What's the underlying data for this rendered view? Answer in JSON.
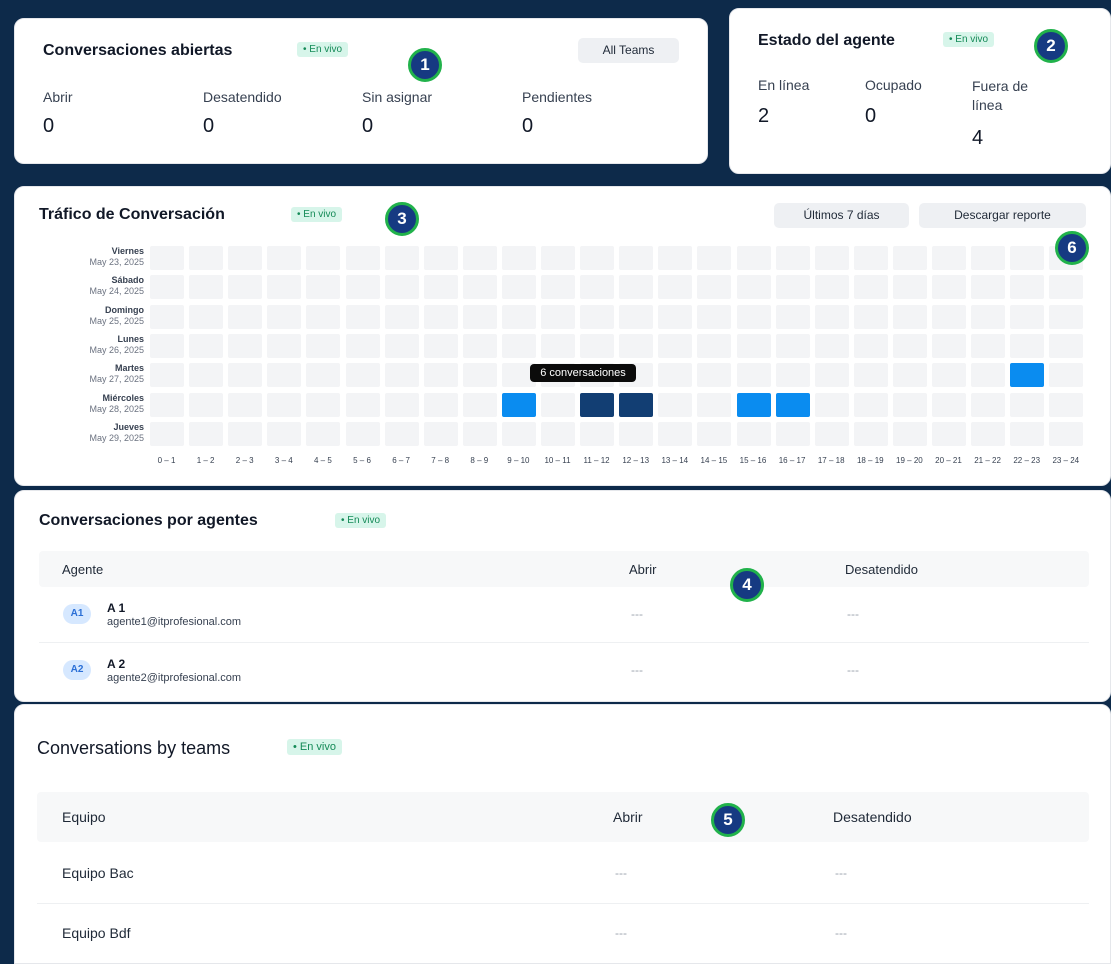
{
  "live_label": "• En vivo",
  "open_conversations": {
    "title": "Conversaciones abiertas",
    "team_filter": "All Teams",
    "stats": [
      {
        "label": "Abrir",
        "value": "0"
      },
      {
        "label": "Desatendido",
        "value": "0"
      },
      {
        "label": "Sin asignar",
        "value": "0"
      },
      {
        "label": "Pendientes",
        "value": "0"
      }
    ]
  },
  "agent_status": {
    "title": "Estado del agente",
    "stats": [
      {
        "label": "En línea",
        "value": "2"
      },
      {
        "label": "Ocupado",
        "value": "0"
      },
      {
        "label": "Fuera de línea",
        "value": "4"
      }
    ]
  },
  "traffic": {
    "title": "Tráfico de Conversación",
    "range_button": "Últimos 7 días",
    "download_button": "Descargar reporte",
    "tooltip": "6 conversaciones"
  },
  "chart_data": {
    "type": "heatmap",
    "days": [
      {
        "day": "Viernes",
        "date": "May 23, 2025"
      },
      {
        "day": "Sábado",
        "date": "May 24, 2025"
      },
      {
        "day": "Domingo",
        "date": "May 25, 2025"
      },
      {
        "day": "Lunes",
        "date": "May 26, 2025"
      },
      {
        "day": "Martes",
        "date": "May 27, 2025"
      },
      {
        "day": "Miércoles",
        "date": "May 28, 2025"
      },
      {
        "day": "Jueves",
        "date": "May 29, 2025"
      }
    ],
    "hours": [
      "0 – 1",
      "1 – 2",
      "2 – 3",
      "3 – 4",
      "4 – 5",
      "5 – 6",
      "6 – 7",
      "7 – 8",
      "8 – 9",
      "9 – 10",
      "10 – 11",
      "11 – 12",
      "12 – 13",
      "13 – 14",
      "14 – 15",
      "15 – 16",
      "16 – 17",
      "17 – 18",
      "18 – 19",
      "19 – 20",
      "20 – 21",
      "21 – 22",
      "22 – 23",
      "23 – 24"
    ],
    "active_cells": [
      {
        "day": 4,
        "hour": 22,
        "level": "medium"
      },
      {
        "day": 5,
        "hour": 9,
        "level": "medium"
      },
      {
        "day": 5,
        "hour": 11,
        "level": "high"
      },
      {
        "day": 5,
        "hour": 12,
        "level": "high",
        "tooltip": "6 conversaciones"
      },
      {
        "day": 5,
        "hour": 15,
        "level": "medium"
      },
      {
        "day": 5,
        "hour": 16,
        "level": "medium"
      }
    ],
    "colors": {
      "empty": "#f3f4f6",
      "medium": "#0a8cf0",
      "high": "#123e73"
    }
  },
  "agents_table": {
    "title": "Conversaciones por agentes",
    "headers": [
      "Agente",
      "Abrir",
      "Desatendido"
    ],
    "rows": [
      {
        "initials": "A1",
        "name": "A 1",
        "email": "agente1@itprofesional.com",
        "open": "---",
        "unattended": "---"
      },
      {
        "initials": "A2",
        "name": "A 2",
        "email": "agente2@itprofesional.com",
        "open": "---",
        "unattended": "---"
      }
    ]
  },
  "teams_table": {
    "title": "Conversations by teams",
    "headers": [
      "Equipo",
      "Abrir",
      "Desatendido"
    ],
    "rows": [
      {
        "name": "Equipo Bac",
        "open": "---",
        "unattended": "---"
      },
      {
        "name": "Equipo Bdf",
        "open": "---",
        "unattended": "---"
      }
    ]
  },
  "markers": [
    "1",
    "2",
    "3",
    "4",
    "5",
    "6"
  ]
}
